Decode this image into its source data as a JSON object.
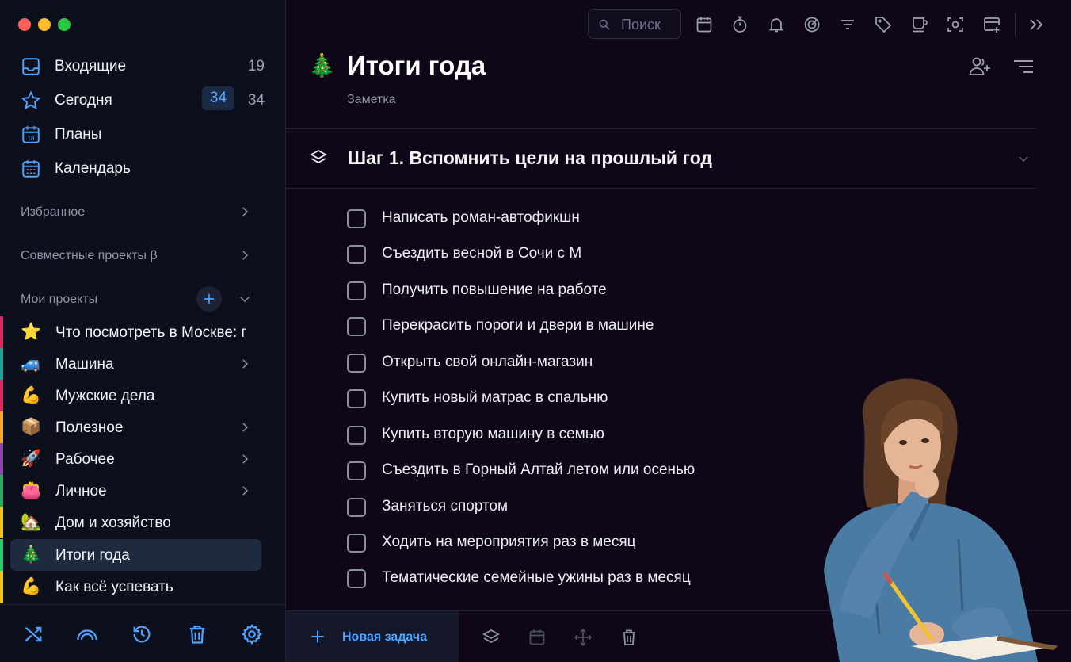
{
  "sidebar": {
    "nav": [
      {
        "label": "Входящие",
        "count": "19",
        "icon": "inbox-icon"
      },
      {
        "label": "Сегодня",
        "badge": "34",
        "count": "34",
        "icon": "star-icon"
      },
      {
        "label": "Планы",
        "icon": "calendar-18-icon"
      },
      {
        "label": "Календарь",
        "icon": "calendar-grid-icon"
      }
    ],
    "favorites_label": "Избранное",
    "shared_label": "Совместные проекты β",
    "my_projects_label": "Мои проекты",
    "projects": [
      {
        "emoji": "⭐",
        "label": "Что посмотреть в Москве: г",
        "color": "#e0245e",
        "has_children": false
      },
      {
        "emoji": "🚙",
        "label": "Машина",
        "color": "#1fa39a",
        "has_children": true
      },
      {
        "emoji": "💪",
        "label": "Мужские дела",
        "color": "#e0245e",
        "has_children": false
      },
      {
        "emoji": "📦",
        "label": "Полезное",
        "color": "#f5a623",
        "has_children": true
      },
      {
        "emoji": "🚀",
        "label": "Рабочее",
        "color": "#8e44ad",
        "has_children": true
      },
      {
        "emoji": "👛",
        "label": "Личное",
        "color": "#27ae60",
        "has_children": true
      },
      {
        "emoji": "🏡",
        "label": "Дом и хозяйство",
        "color": "#f1c40f",
        "has_children": false
      },
      {
        "emoji": "🎄",
        "label": "Итоги года",
        "color": "#2ecc71",
        "has_children": false,
        "active": true
      },
      {
        "emoji": "💪",
        "label": "Как всё успевать",
        "color": "#f1c40f",
        "has_children": false
      }
    ],
    "bottom_icons": [
      "shuffle-icon",
      "rainbow-icon",
      "history-icon",
      "trash-icon",
      "gear-icon"
    ]
  },
  "toolbar": {
    "search_placeholder": "Поиск",
    "icons": [
      "calendar-icon",
      "timer-icon",
      "bell-icon",
      "focus-icon",
      "filter-icon",
      "tag-icon",
      "coffee-icon",
      "scan-icon",
      "add-window-icon",
      "expand-icon"
    ]
  },
  "page": {
    "title_emoji": "🎄",
    "title": "Итоги года",
    "subtitle": "Заметка",
    "step_title": "Шаг 1. Вспомнить цели на прошлый год"
  },
  "tasks": [
    "Написать роман-автофикшн",
    "Съездить весной в Сочи с М",
    "Получить повышение на работе",
    "Перекрасить пороги и двери в машине",
    "Открыть свой онлайн-магазин",
    "Купить новый матрас в спальню",
    "Купить вторую машину в семью",
    "Съездить в Горный Алтай летом или осенью",
    "Заняться спортом",
    "Ходить на мероприятия раз в месяц",
    "Тематические семейные ужины раз в месяц"
  ],
  "bottombar": {
    "new_task_label": "Новая задача",
    "icons": [
      "layers-icon",
      "calendar-icon",
      "move-icon",
      "trash-icon"
    ]
  },
  "colors": {
    "accent": "#4ea3ff",
    "background": "#0f0718",
    "sidebar_bg": "#0c0f1c"
  }
}
